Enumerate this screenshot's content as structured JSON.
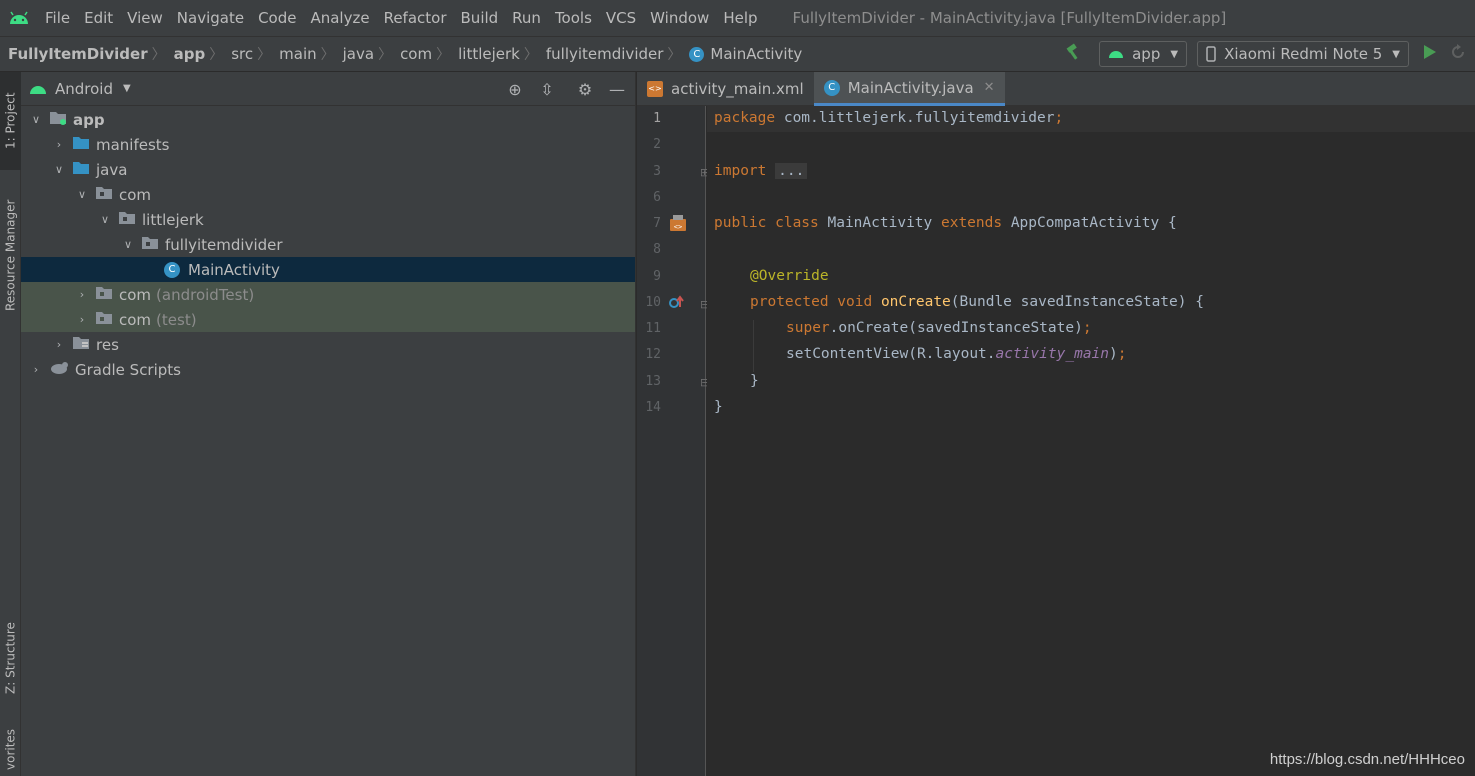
{
  "menubar": {
    "items": [
      "File",
      "Edit",
      "View",
      "Navigate",
      "Code",
      "Analyze",
      "Refactor",
      "Build",
      "Run",
      "Tools",
      "VCS",
      "Window",
      "Help"
    ],
    "title": "FullyItemDivider - MainActivity.java [FullyItemDivider.app]"
  },
  "breadcrumb": [
    "FullyItemDivider",
    "app",
    "src",
    "main",
    "java",
    "com",
    "littlejerk",
    "fullyitemdivider",
    "MainActivity"
  ],
  "toolbar": {
    "config": "app",
    "device": "Xiaomi Redmi Note 5"
  },
  "side_tabs": {
    "project": "1: Project",
    "resource_manager": "Resource Manager",
    "structure": "Z: Structure",
    "favorites": "vorites"
  },
  "project": {
    "view": "Android",
    "tree": [
      {
        "label": "app",
        "extra": "",
        "expanded": true
      },
      {
        "label": "manifests",
        "extra": "",
        "expanded": false
      },
      {
        "label": "java",
        "extra": "",
        "expanded": true
      },
      {
        "label": "com",
        "extra": "",
        "expanded": true
      },
      {
        "label": "littlejerk",
        "extra": "",
        "expanded": true
      },
      {
        "label": "fullyitemdivider",
        "extra": "",
        "expanded": true
      },
      {
        "label": "MainActivity",
        "extra": "",
        "expanded": false
      },
      {
        "label": "com",
        "extra": "(androidTest)",
        "expanded": false
      },
      {
        "label": "com",
        "extra": "(test)",
        "expanded": false
      },
      {
        "label": "res",
        "extra": "",
        "expanded": false
      },
      {
        "label": "Gradle Scripts",
        "extra": "",
        "expanded": false
      }
    ]
  },
  "editor": {
    "tabs": [
      {
        "label": "activity_main.xml",
        "active": false
      },
      {
        "label": "MainActivity.java",
        "active": true
      }
    ],
    "line_numbers": [
      "1",
      "2",
      "3",
      "6",
      "7",
      "8",
      "9",
      "10",
      "11",
      "12",
      "13",
      "14"
    ],
    "code": {
      "l1_kw": "package",
      "l1_rest": " com.littlejerk.fullyitemdivider",
      "l1_semi": ";",
      "l3_kw": "import",
      "l3_fold": "...",
      "l7_kw1": "public class",
      "l7_name": " MainActivity ",
      "l7_kw2": "extends",
      "l7_rest": " AppCompatActivity {",
      "l9_ann": "@Override",
      "l10_kw": "protected void",
      "l10_fn": " onCreate",
      "l10_rest": "(Bundle savedInstanceState) {",
      "l11_kw": "super",
      "l11_rest": ".onCreate(savedInstanceState)",
      "l11_semi": ";",
      "l12_a": "setContentView(R.layout.",
      "l12_it": "activity_main",
      "l12_b": ")",
      "l12_semi": ";",
      "l13": "}",
      "l14": "}"
    }
  },
  "watermark": "https://blog.csdn.net/HHHceo"
}
